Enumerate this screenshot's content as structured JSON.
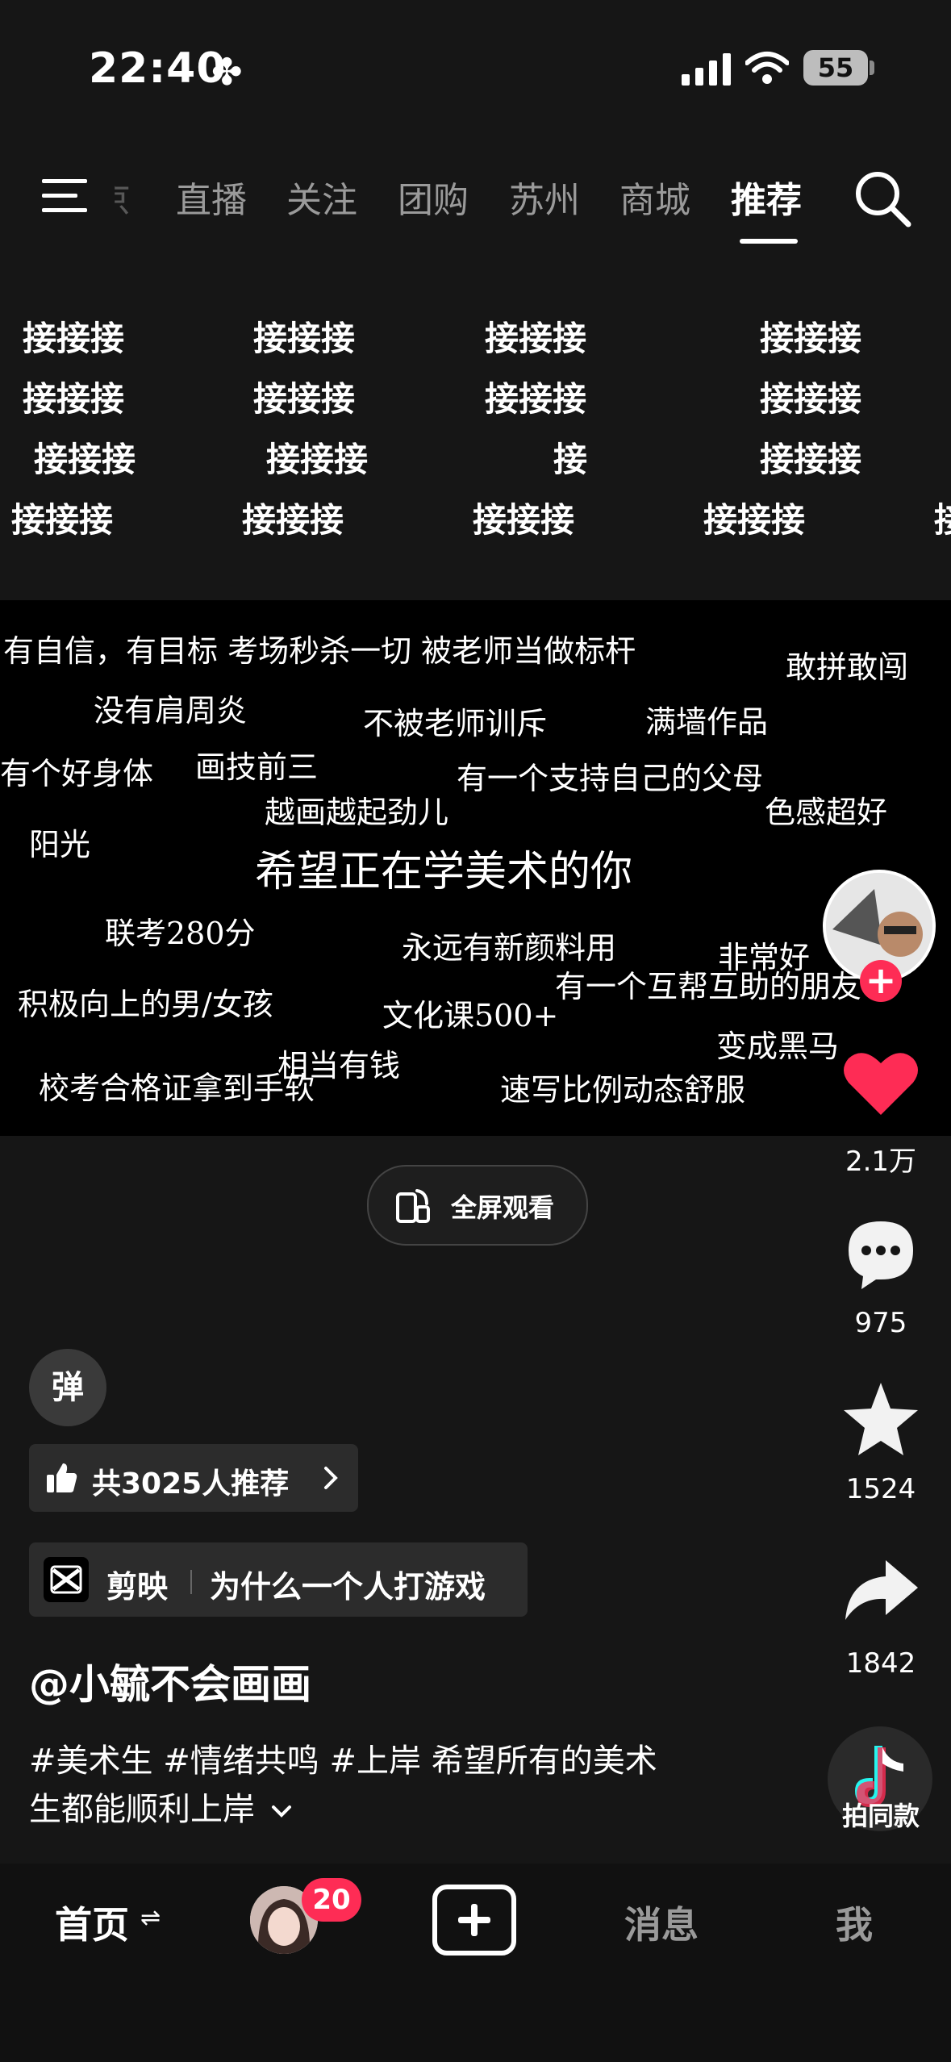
{
  "status": {
    "time": "22:40",
    "battery": "55"
  },
  "nav": {
    "tabs": [
      "京",
      "直播",
      "关注",
      "团购",
      "苏州",
      "商城",
      "推荐"
    ],
    "active_tab": "推荐"
  },
  "text_grid": {
    "word": "接接接",
    "single": "接"
  },
  "video_text": {
    "t1": "有自信，有目标 考场秒杀一切 被老师当做标杆",
    "t2": "敢拼敢闯",
    "t3": "没有肩周炎",
    "t4": "不被老师训斥",
    "t5": "满墙作品",
    "t6": "有个好身体",
    "t7": "画技前三",
    "t8": "有一个支持自己的父母",
    "t9": "越画越起劲儿",
    "t10": "色感超好",
    "t11": "阳光",
    "t12": "希望正在学美术的你",
    "t13": "联考280分",
    "t14": "永远有新颜料用",
    "t15": "非常好",
    "t16": "积极向上的男/女孩",
    "t17": "有一个互帮互助的朋友",
    "t18": "文化课500+",
    "t19": "变成黑马",
    "t20": "相当有钱",
    "t21": "校考合格证拿到手软",
    "t22": "速写比例动态舒服"
  },
  "fullscreen_label": "全屏观看",
  "danmu_label": "弹",
  "recommend_label": "共3025人推荐",
  "app": {
    "name": "剪映",
    "title": "为什么一个人打游戏"
  },
  "author": "@小毓不会画画",
  "description": {
    "line1": "#美术生 #情绪共鸣 #上岸 希望所有的美术",
    "line2": "生都能顺利上岸"
  },
  "rail": {
    "likes": "2.1万",
    "comments": "975",
    "favorites": "1524",
    "shares": "1842",
    "same_label": "拍同款"
  },
  "bottom_nav": {
    "home": "首页",
    "badge": "20",
    "messages": "消息",
    "me": "我"
  },
  "colors": {
    "accent": "#fe2c55",
    "background": "#161616"
  }
}
